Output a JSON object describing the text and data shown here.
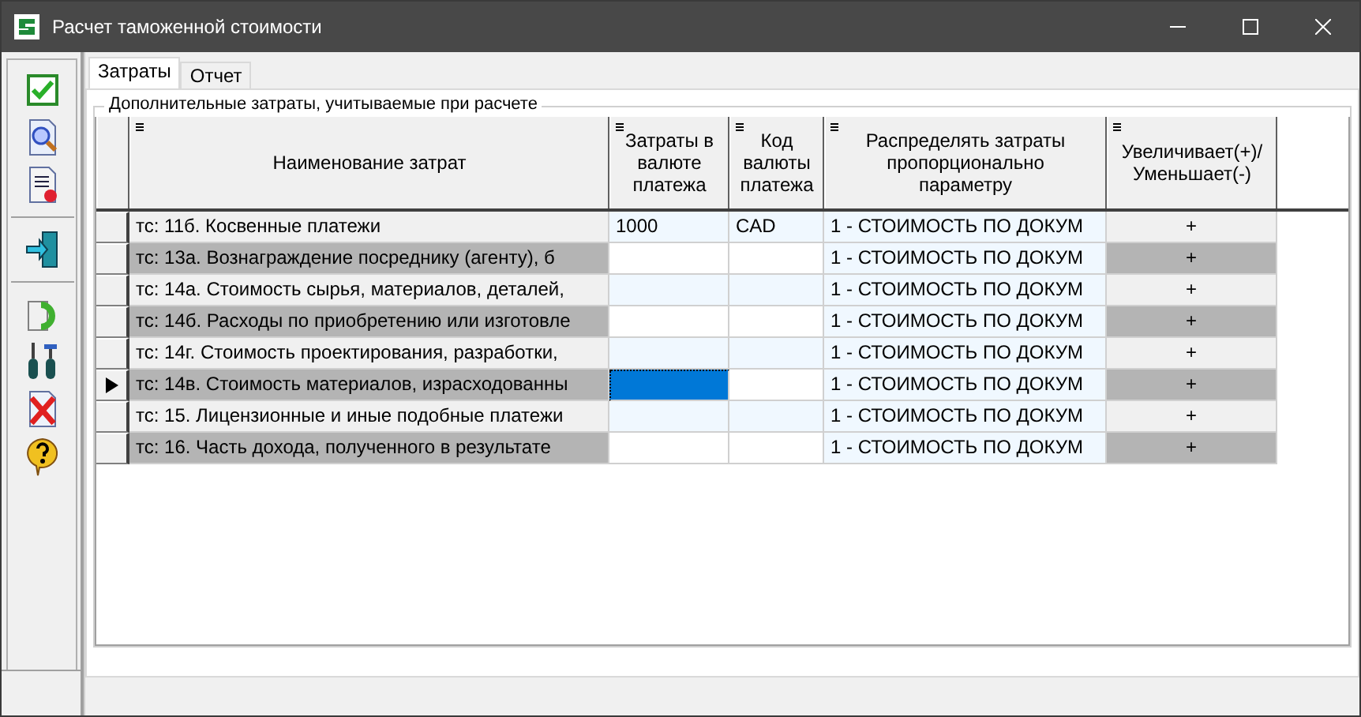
{
  "window": {
    "title": "Расчет таможенной стоимости"
  },
  "tabs": [
    {
      "label": "Затраты",
      "selected": true
    },
    {
      "label": "Отчет",
      "selected": false
    }
  ],
  "group": {
    "title": "Дополнительные затраты, учитываемые при расчете"
  },
  "table": {
    "columns": [
      "Наименование затрат",
      "Затраты в валюте платежа",
      "Код валюты платежа",
      "Распределять затраты пропорционально параметру",
      "Увеличивает(+)/ Уменьшает(-)"
    ],
    "rows": [
      {
        "name": "тс: 11б. Косвенные платежи",
        "amount": "1000",
        "currency": "CAD",
        "distribution": "1 - СТОИМОСТЬ ПО ДОКУМ",
        "sign": "+",
        "selected": false
      },
      {
        "name": "тс: 13а. Вознаграждение посреднику (агенту), б",
        "distribution": "1 - СТОИМОСТЬ ПО ДОКУМ",
        "sign": "+",
        "selected": false
      },
      {
        "name": "тс: 14а. Стоимость сырья, материалов, деталей,",
        "distribution": "1 - СТОИМОСТЬ ПО ДОКУМ",
        "sign": "+",
        "selected": false
      },
      {
        "name": "тс: 14б. Расходы по приобретению или изготовле",
        "distribution": "1 - СТОИМОСТЬ ПО ДОКУМ",
        "sign": "+",
        "selected": false
      },
      {
        "name": "тс: 14г. Стоимость проектирования, разработки,",
        "distribution": "1 - СТОИМОСТЬ ПО ДОКУМ",
        "sign": "+",
        "selected": false
      },
      {
        "name": "тс: 14в. Стоимость материалов, израсходованны",
        "distribution": "1 - СТОИМОСТЬ ПО ДОКУМ",
        "sign": "+",
        "selected": true
      },
      {
        "name": "тс: 15. Лицензионные и иные подобные платежи",
        "distribution": "1 - СТОИМОСТЬ ПО ДОКУМ",
        "sign": "+",
        "selected": false
      },
      {
        "name": "тс: 16. Часть дохода, полученного в результате",
        "distribution": "1 - СТОИМОСТЬ ПО ДОКУМ",
        "sign": "+",
        "selected": false
      }
    ]
  }
}
